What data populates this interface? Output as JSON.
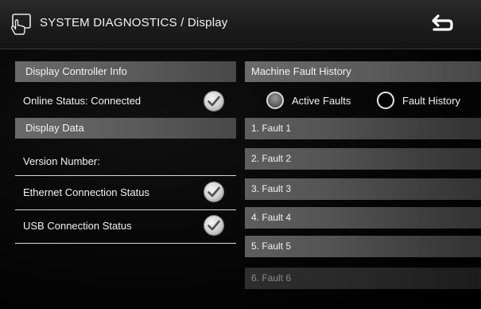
{
  "header": {
    "title": "SYSTEM DIAGNOSTICS / Display"
  },
  "left_panel": {
    "controller_section": {
      "header": "Display Controller Info",
      "online_status": {
        "label": "Online Status: Connected",
        "checked": true
      }
    },
    "data_section": {
      "header": "Display Data",
      "rows": [
        {
          "label": "Version Number:",
          "checked": false
        },
        {
          "label": "Ethernet Connection Status",
          "checked": true
        },
        {
          "label": "USB Connection Status",
          "checked": true
        }
      ]
    }
  },
  "right_panel": {
    "header": "Machine Fault History",
    "radios": [
      {
        "label": "Active Faults",
        "selected": true
      },
      {
        "label": "Fault History",
        "selected": false
      }
    ],
    "faults": [
      "1. Fault 1",
      "2. Fault 2",
      "3. Fault 3",
      "4. Fault 4",
      "5. Fault 5",
      "6. Fault 6"
    ]
  },
  "colors": {
    "background": "#000000",
    "header_bar": "#1c1c1c",
    "section_header": "#5a5a5a",
    "text": "#f2f2f2",
    "dim_text": "#8a8a8a"
  }
}
